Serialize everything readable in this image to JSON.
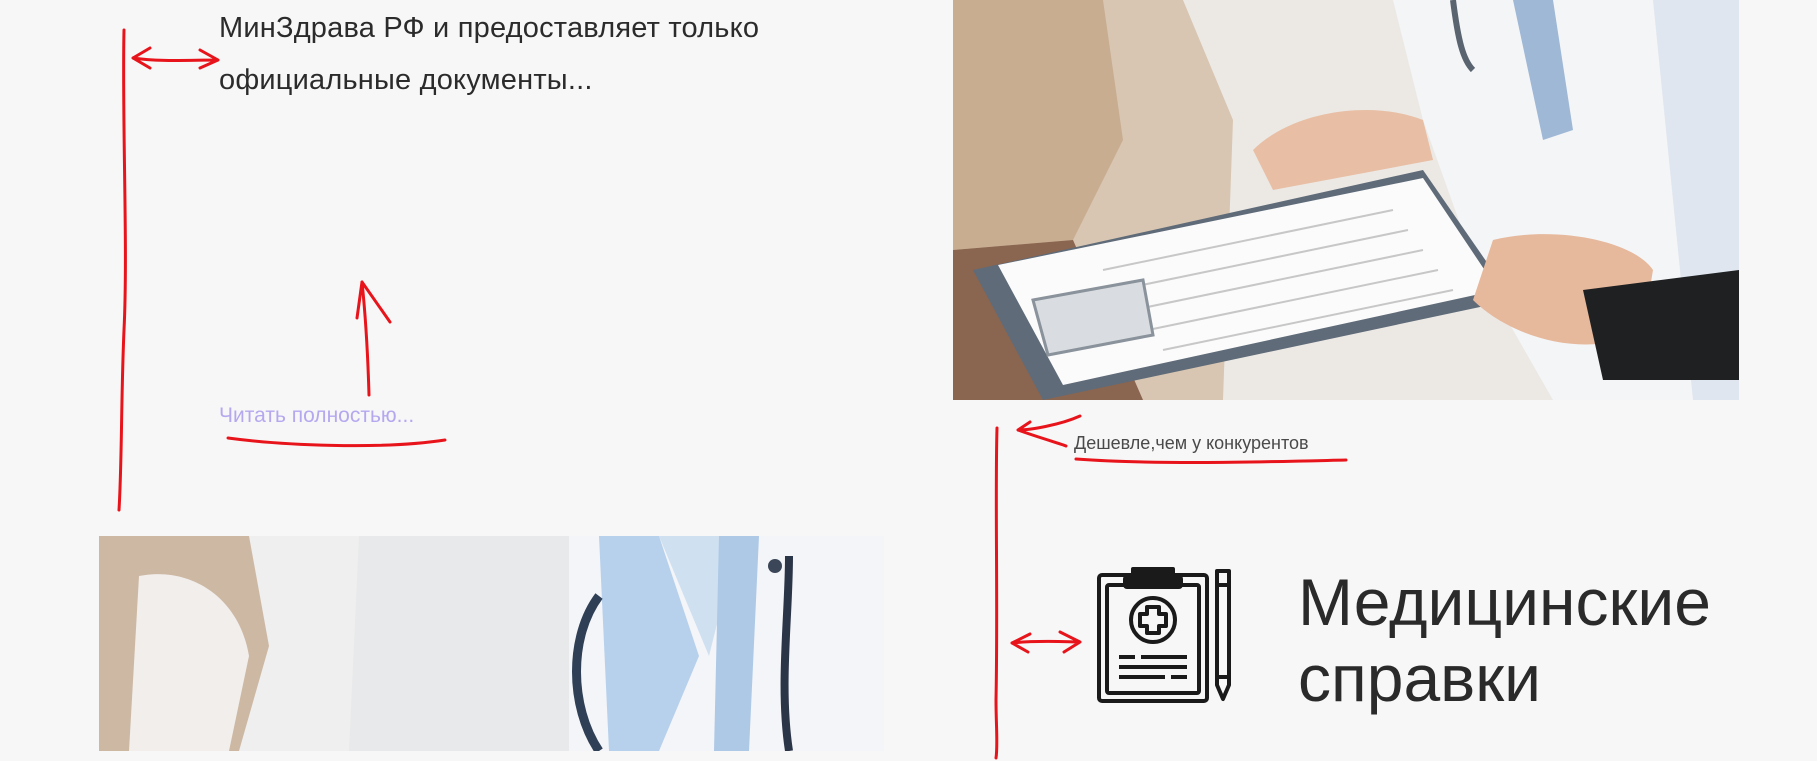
{
  "intro": {
    "text": "МинЗдрава РФ и предоставляет только официальные документы...",
    "read_more_label": "Читать полностью..."
  },
  "promo": {
    "tagline": "Дешевле,чем у конкурентов",
    "icon": "medical-clipboard-icon",
    "title": "Медицинские справки"
  },
  "photos": {
    "top": "doctor-holding-clipboard-photo",
    "bottom": "doctor-with-patient-photo"
  },
  "colors": {
    "background": "#f7f7f7",
    "body_text": "#2b2b2b",
    "link": "#b6a8ef",
    "annotation": "#e8141b"
  }
}
